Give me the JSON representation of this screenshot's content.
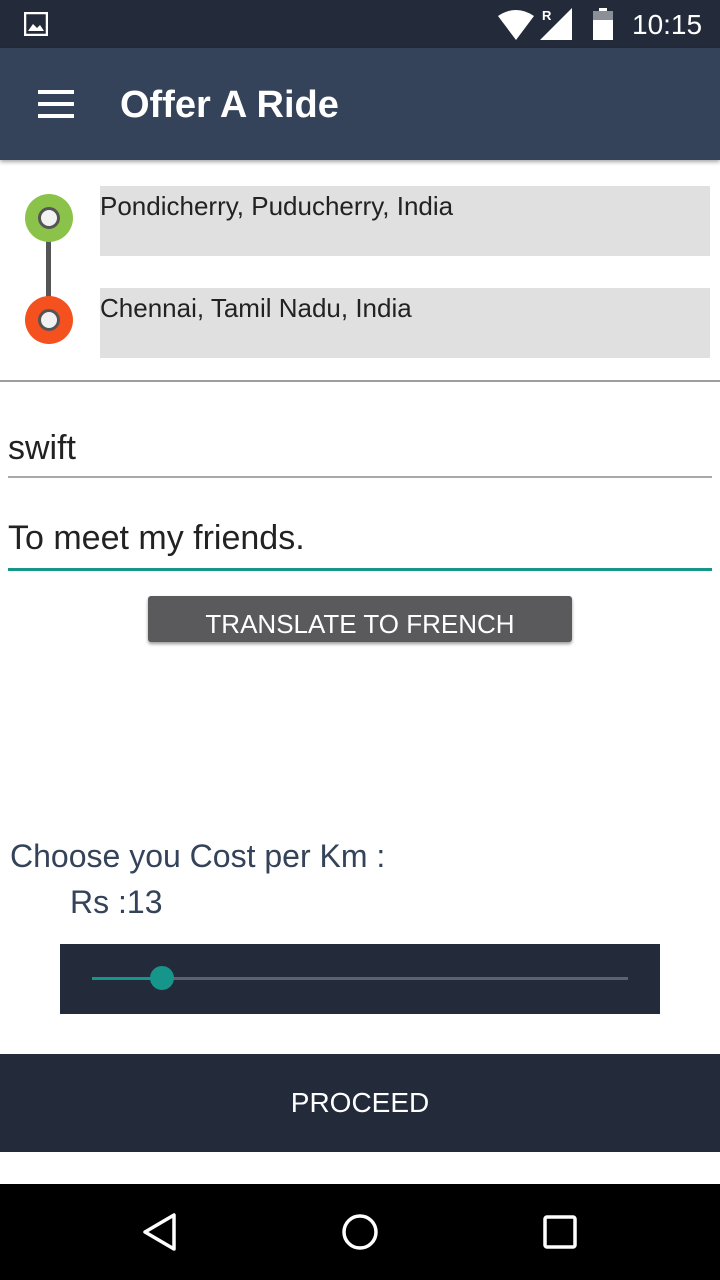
{
  "status_bar": {
    "time": "10:15",
    "icons": [
      "gallery-icon",
      "wifi-icon",
      "signal-icon",
      "battery-icon"
    ]
  },
  "app_bar": {
    "title": "Offer A Ride",
    "menu_icon": "hamburger-menu-icon"
  },
  "route": {
    "from": "Pondicherry, Puducherry, India",
    "to": "Chennai, Tamil Nadu, India",
    "start_pin_color": "#8bc34a",
    "end_pin_color": "#f4511e"
  },
  "form": {
    "car_name": "swift",
    "purpose": "To meet my friends."
  },
  "translate_button": {
    "label": "TRANSLATE TO FRENCH"
  },
  "cost": {
    "label": "Choose you Cost per Km :",
    "value_text": "Rs :13",
    "slider_fraction": 0.13
  },
  "proceed_button": {
    "label": "PROCEED"
  },
  "colors": {
    "primary": "#34435a",
    "primary_dark": "#232a3a",
    "accent": "#16958a"
  },
  "nav_bar": {
    "icons": [
      "back-icon",
      "home-icon",
      "recents-icon"
    ]
  }
}
